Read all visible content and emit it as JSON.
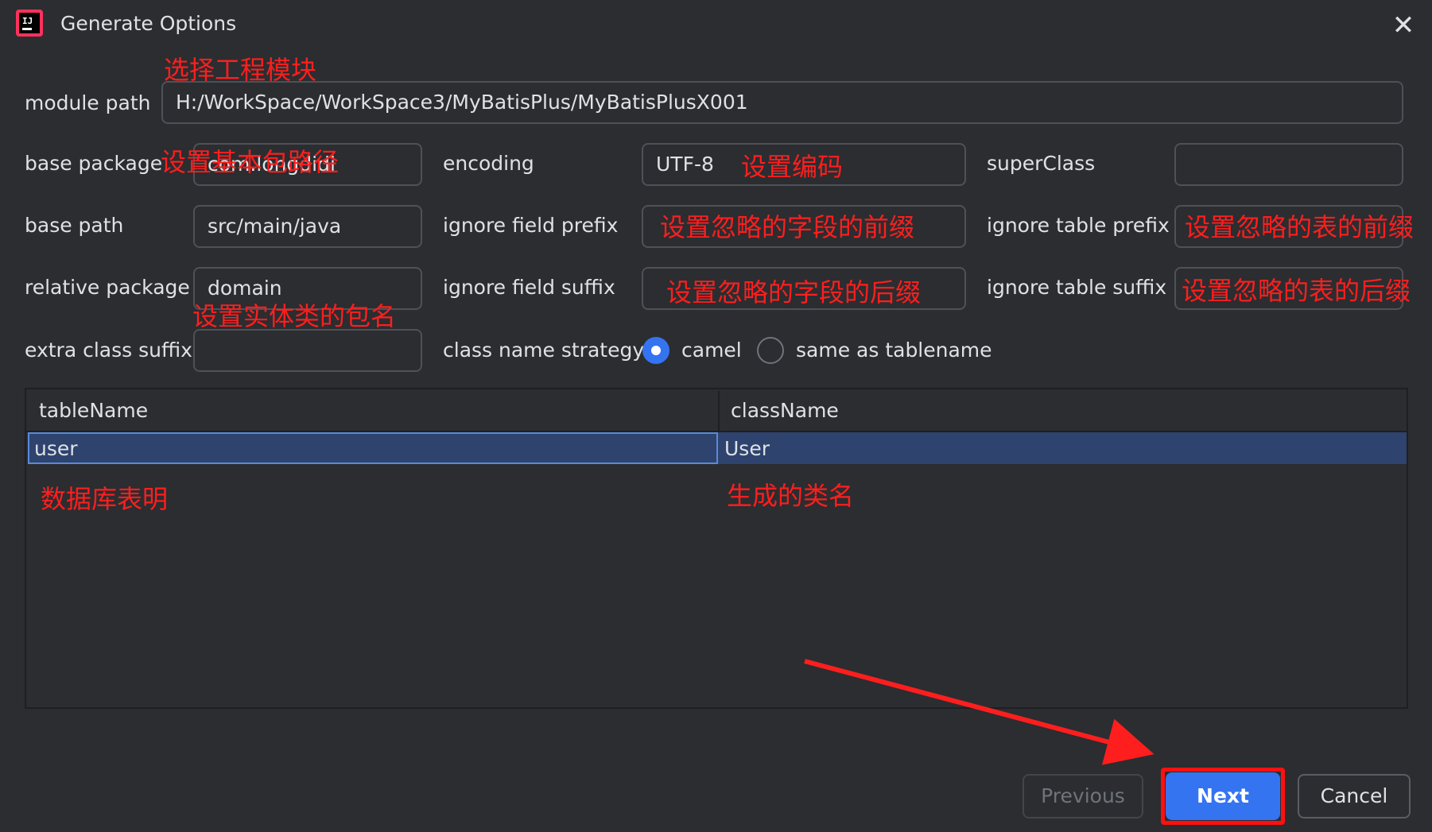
{
  "window": {
    "title": "Generate Options",
    "app_icon": "intellij-icon",
    "close_icon": "close-icon"
  },
  "form": {
    "module_path": {
      "label": "module path",
      "value": "H:/WorkSpace/WorkSpace3/MyBatisPlus/MyBatisPlusX001"
    },
    "base_package": {
      "label": "base package",
      "value": "com.longdidi"
    },
    "encoding": {
      "label": "encoding",
      "value": "UTF-8"
    },
    "super_class": {
      "label": "superClass",
      "value": ""
    },
    "base_path": {
      "label": "base path",
      "value": "src/main/java"
    },
    "ignore_field_prefix": {
      "label": "ignore field prefix",
      "value": ""
    },
    "ignore_table_prefix": {
      "label": "ignore table prefix",
      "value": ""
    },
    "relative_package": {
      "label": "relative package",
      "value": "domain"
    },
    "ignore_field_suffix": {
      "label": "ignore field suffix",
      "value": ""
    },
    "ignore_table_suffix": {
      "label": "ignore table suffix",
      "value": ""
    },
    "extra_class_suffix": {
      "label": "extra class suffix",
      "value": ""
    },
    "class_name_strategy": {
      "label": "class name strategy",
      "options": [
        "camel",
        "same as tablename"
      ],
      "selected": "camel"
    }
  },
  "table": {
    "columns": [
      "tableName",
      "className"
    ],
    "rows": [
      {
        "tableName": "user",
        "className": "User"
      }
    ]
  },
  "buttons": {
    "previous": "Previous",
    "next": "Next",
    "cancel": "Cancel"
  },
  "annotations": {
    "module_path": "选择工程模块",
    "base_package": "设置基本包路径",
    "encoding": "设置编码",
    "ignore_field_prefix": "设置忽略的字段的前缀",
    "ignore_table_prefix": "设置忽略的表的前缀",
    "ignore_field_suffix": "设置忽略的字段的后缀",
    "ignore_table_suffix": "设置忽略的表的后缀",
    "relative_package": "设置实体类的包名",
    "table_name": "数据库表明",
    "class_name": "生成的类名"
  },
  "colors": {
    "background": "#2b2d30",
    "accent": "#3574f0",
    "annotation": "#ff1e1e",
    "selected_row": "#2e436e"
  }
}
